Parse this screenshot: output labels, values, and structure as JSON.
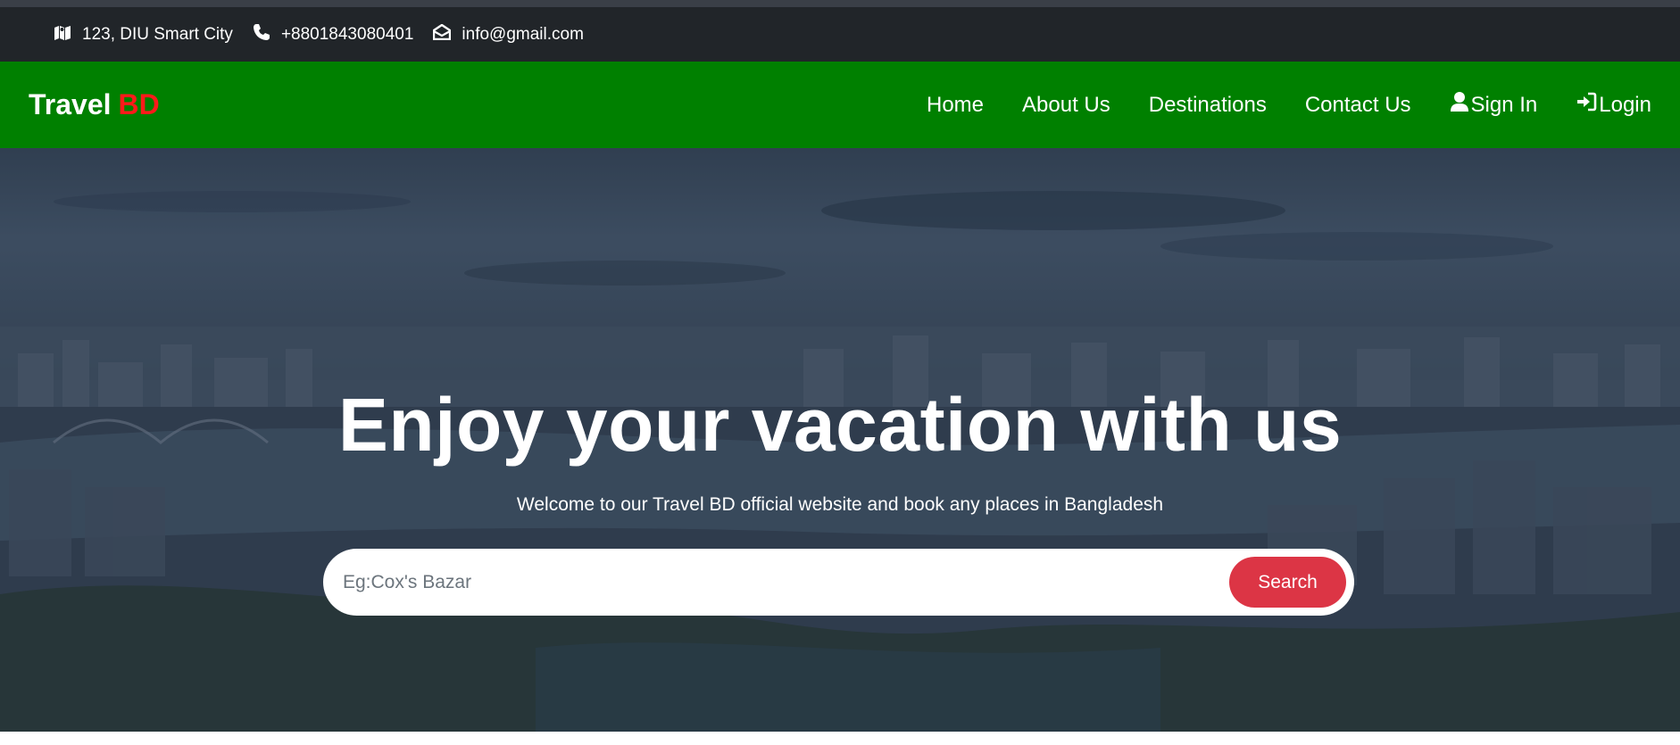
{
  "topbar": {
    "address": "123, DIU Smart City",
    "phone": "+8801843080401",
    "email": "info@gmail.com",
    "address_icon": "map-icon",
    "phone_icon": "phone-icon",
    "email_icon": "envelope-open-icon"
  },
  "navbar": {
    "brand_main": "Travel",
    "brand_accent": "BD",
    "links": [
      {
        "label": "Home"
      },
      {
        "label": "About Us"
      },
      {
        "label": "Destinations"
      },
      {
        "label": "Contact Us"
      },
      {
        "label": "Sign In",
        "icon": "user-icon"
      },
      {
        "label": "Login",
        "icon": "sign-in-icon"
      }
    ]
  },
  "hero": {
    "title": "Enjoy your vacation with us",
    "subtitle": "Welcome to our Travel BD official website and book any places in Bangladesh",
    "search": {
      "placeholder": "Eg:Cox's Bazar",
      "value": "",
      "button_label": "Search"
    }
  },
  "colors": {
    "topbar_bg": "#212529",
    "navbar_bg": "#008000",
    "brand_accent": "#ff1a1a",
    "search_button": "#dc3545"
  }
}
